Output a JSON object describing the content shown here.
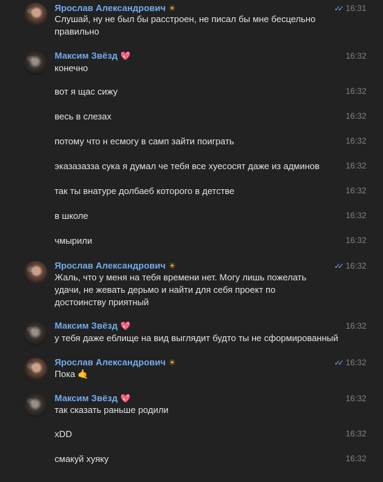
{
  "messages": [
    {
      "author": "Ярослав Александрович",
      "badge": "☀",
      "time": "16:31",
      "read": true,
      "text": "Слушай, ну не был бы расстроен, не писал бы мне бесцельно правильно"
    },
    {
      "author": "Максим Звёзд",
      "badge": "💖",
      "time": "16:32",
      "text": "конечно"
    },
    {
      "time": "16:32",
      "text": "вот я щас сижу"
    },
    {
      "time": "16:32",
      "text": "весь в слезах"
    },
    {
      "time": "16:32",
      "text": "потому что н есмогу в самп зайти поиграть"
    },
    {
      "time": "16:32",
      "text": "эказазазза сука я думал че тебя все хуесосят даже из админов"
    },
    {
      "time": "16:32",
      "text": "так ты внатуре долбаеб которого в детстве"
    },
    {
      "time": "16:32",
      "text": "в школе"
    },
    {
      "time": "16:32",
      "text": "чмырили"
    },
    {
      "author": "Ярослав Александрович",
      "badge": "☀",
      "time": "16:32",
      "read": true,
      "text": "Жаль, что у меня на тебя времени нет. Могу лишь пожелать удачи, не жевать дерьмо и найти для себя проект по достоинству приятный"
    },
    {
      "author": "Максим Звёзд",
      "badge": "💖",
      "time": "16:32",
      "text": "у тебя даже еблище на вид выглядит будто ты не сформированный"
    },
    {
      "author": "Ярослав Александрович",
      "badge": "☀",
      "time": "16:32",
      "read": true,
      "text": "Пока",
      "emoji": "🤙"
    },
    {
      "author": "Максим Звёзд",
      "badge": "💖",
      "time": "16:32",
      "text": "так сказать раньше родили"
    },
    {
      "time": "16:32",
      "text": "xDD"
    },
    {
      "time": "16:32",
      "text": "смакуй хуяку"
    }
  ]
}
